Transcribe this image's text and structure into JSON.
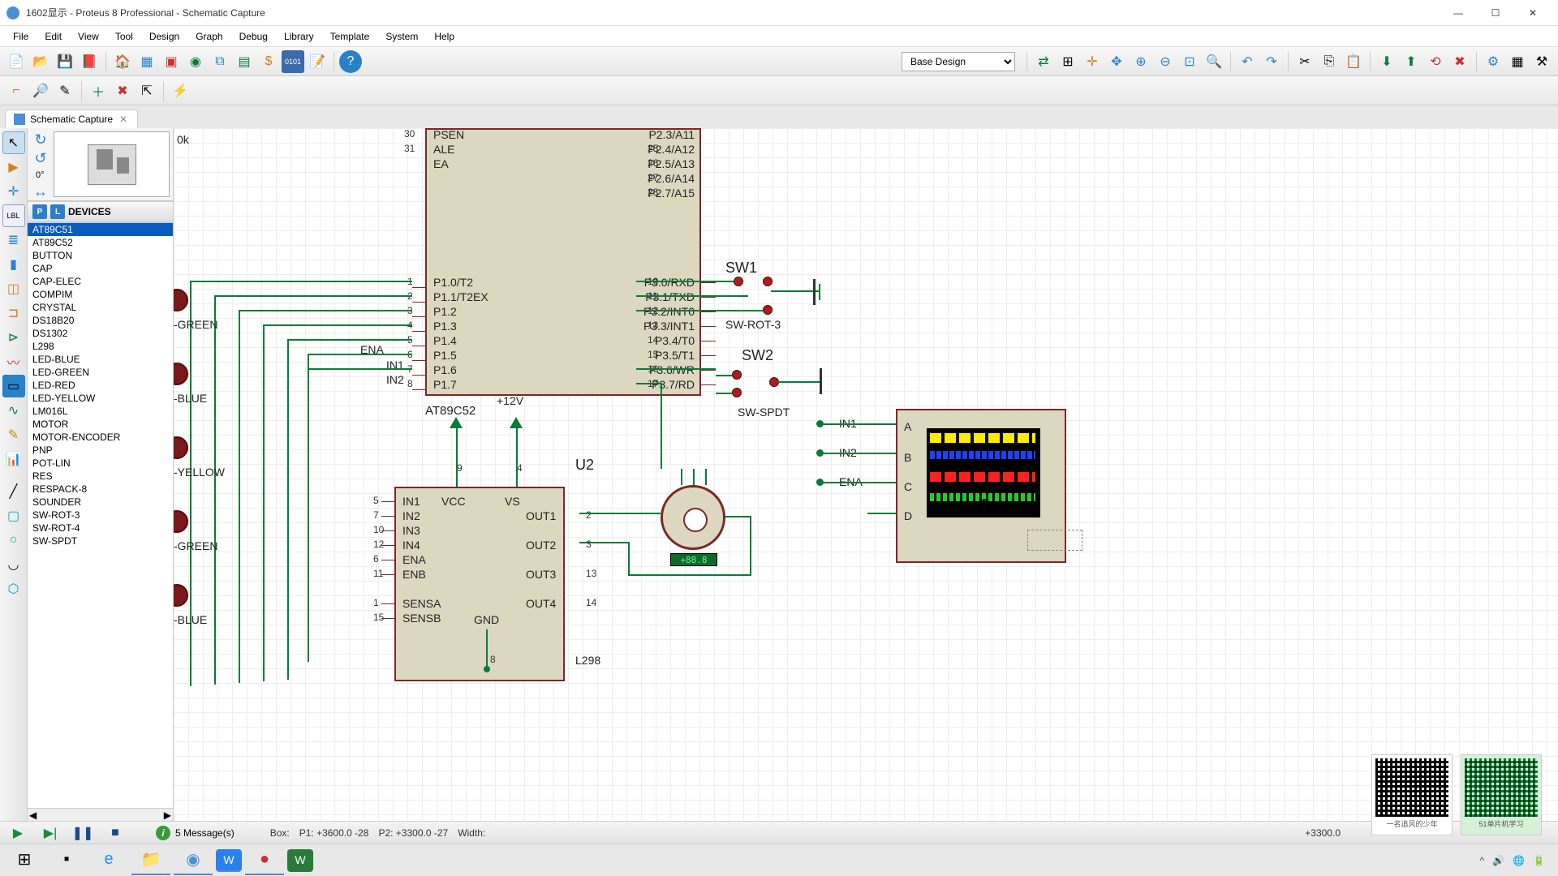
{
  "window": {
    "title": "1602显示 - Proteus 8 Professional - Schematic Capture",
    "min": "—",
    "max": "☐",
    "close": "✕"
  },
  "menu": [
    "File",
    "Edit",
    "View",
    "Tool",
    "Design",
    "Graph",
    "Debug",
    "Library",
    "Template",
    "System",
    "Help"
  ],
  "design_select": "Base Design",
  "tab": {
    "label": "Schematic Capture"
  },
  "panel": {
    "angle": "0°",
    "zoom_hint": "0k",
    "header": "DEVICES",
    "devices": [
      "AT89C51",
      "AT89C52",
      "BUTTON",
      "CAP",
      "CAP-ELEC",
      "COMPIM",
      "CRYSTAL",
      "DS18B20",
      "DS1302",
      "L298",
      "LED-BLUE",
      "LED-GREEN",
      "LED-RED",
      "LED-YELLOW",
      "LM016L",
      "MOTOR",
      "MOTOR-ENCODER",
      "PNP",
      "POT-LIN",
      "RES",
      "RESPACK-8",
      "SOUNDER",
      "SW-ROT-3",
      "SW-ROT-4",
      "SW-SPDT"
    ],
    "selected": 0
  },
  "mcu": {
    "ref": "AT89C52",
    "left_pins": [
      {
        "num": "30",
        "name": "PSEN"
      },
      {
        "num": "31",
        "name": "ALE"
      },
      {
        "num": "",
        "name": "EA"
      },
      {
        "num": "1",
        "name": "P1.0/T2"
      },
      {
        "num": "2",
        "name": "P1.1/T2EX"
      },
      {
        "num": "3",
        "name": "P1.2"
      },
      {
        "num": "4",
        "name": "P1.3"
      },
      {
        "num": "5",
        "name": "P1.4"
      },
      {
        "num": "6",
        "name": "P1.5"
      },
      {
        "num": "7",
        "name": "P1.6"
      },
      {
        "num": "8",
        "name": "P1.7"
      }
    ],
    "right_pins": [
      {
        "num": "",
        "name": "P2.3/A11"
      },
      {
        "num": "25",
        "name": "P2.4/A12"
      },
      {
        "num": "26",
        "name": "P2.5/A13"
      },
      {
        "num": "27",
        "name": "P2.6/A14"
      },
      {
        "num": "28",
        "name": "P2.7/A15"
      },
      {
        "num": "10",
        "name": "P3.0/RXD"
      },
      {
        "num": "11",
        "name": "P3.1/TXD"
      },
      {
        "num": "12",
        "name": "P3.2/INT0"
      },
      {
        "num": "13",
        "name": "P3.3/INT1"
      },
      {
        "num": "14",
        "name": "P3.4/T0"
      },
      {
        "num": "15",
        "name": "P3.5/T1"
      },
      {
        "num": "16",
        "name": "P3.6/WR"
      },
      {
        "num": "17",
        "name": "P3.7/RD"
      }
    ],
    "net_ena": "ENA",
    "net_in1": "IN1",
    "net_in2": "IN2"
  },
  "u2": {
    "ref": "U2",
    "part": "L298",
    "plus12": "+12V",
    "left": [
      {
        "num": "5",
        "name": "IN1"
      },
      {
        "num": "7",
        "name": "IN2"
      },
      {
        "num": "10",
        "name": "IN3"
      },
      {
        "num": "12",
        "name": "IN4"
      },
      {
        "num": "6",
        "name": "ENA"
      },
      {
        "num": "11",
        "name": "ENB"
      },
      {
        "num": "1",
        "name": "SENSA"
      },
      {
        "num": "15",
        "name": "SENSB"
      }
    ],
    "top": [
      {
        "num": "9",
        "name": "VCC"
      },
      {
        "num": "4",
        "name": "VS"
      }
    ],
    "right": [
      {
        "num": "2",
        "name": "OUT1"
      },
      {
        "num": "3",
        "name": "OUT2"
      },
      {
        "num": "13",
        "name": "OUT3"
      },
      {
        "num": "14",
        "name": "OUT4"
      }
    ],
    "bottom": {
      "num": "8",
      "name": "GND"
    }
  },
  "leds": [
    "-GREEN",
    "-BLUE",
    "-YELLOW",
    "-GREEN",
    "-BLUE"
  ],
  "sw1": {
    "ref": "SW1",
    "part": "SW-ROT-3"
  },
  "sw2": {
    "ref": "SW2",
    "part": "SW-SPDT"
  },
  "scope": {
    "in1": "IN1",
    "in2": "IN2",
    "ena": "ENA",
    "ch": [
      "A",
      "B",
      "C",
      "D"
    ]
  },
  "motor": {
    "display": "+88.8"
  },
  "status": {
    "messages": "5 Message(s)",
    "box": "Box:",
    "p1": "P1:   +3600.0    -28",
    "p2": "P2:   +3300.0    -27",
    "width": "Width:",
    "coord": "+3300.0"
  },
  "qr": {
    "label1": "一名追风的少年",
    "label2": "51单片机学习"
  }
}
